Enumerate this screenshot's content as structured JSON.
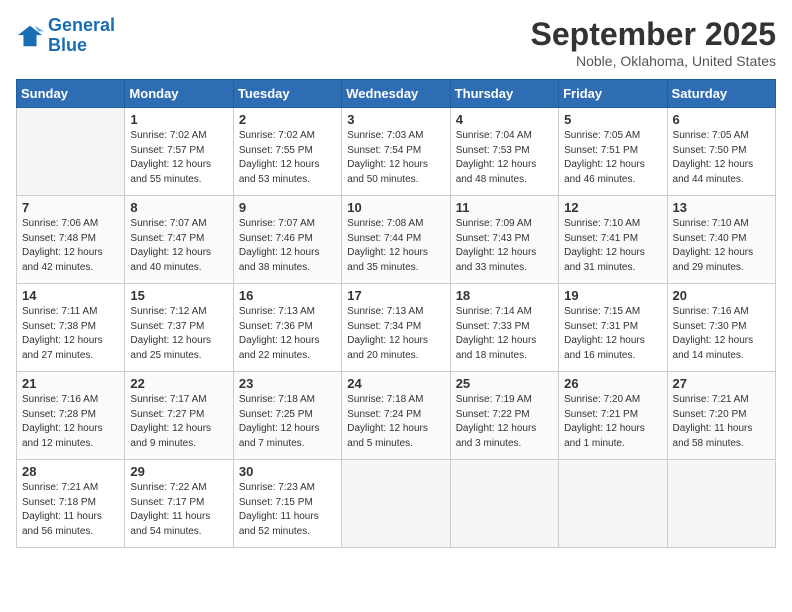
{
  "header": {
    "logo_line1": "General",
    "logo_line2": "Blue",
    "month_title": "September 2025",
    "location": "Noble, Oklahoma, United States"
  },
  "days_of_week": [
    "Sunday",
    "Monday",
    "Tuesday",
    "Wednesday",
    "Thursday",
    "Friday",
    "Saturday"
  ],
  "weeks": [
    [
      {
        "day": "",
        "info": ""
      },
      {
        "day": "1",
        "info": "Sunrise: 7:02 AM\nSunset: 7:57 PM\nDaylight: 12 hours\nand 55 minutes."
      },
      {
        "day": "2",
        "info": "Sunrise: 7:02 AM\nSunset: 7:55 PM\nDaylight: 12 hours\nand 53 minutes."
      },
      {
        "day": "3",
        "info": "Sunrise: 7:03 AM\nSunset: 7:54 PM\nDaylight: 12 hours\nand 50 minutes."
      },
      {
        "day": "4",
        "info": "Sunrise: 7:04 AM\nSunset: 7:53 PM\nDaylight: 12 hours\nand 48 minutes."
      },
      {
        "day": "5",
        "info": "Sunrise: 7:05 AM\nSunset: 7:51 PM\nDaylight: 12 hours\nand 46 minutes."
      },
      {
        "day": "6",
        "info": "Sunrise: 7:05 AM\nSunset: 7:50 PM\nDaylight: 12 hours\nand 44 minutes."
      }
    ],
    [
      {
        "day": "7",
        "info": "Sunrise: 7:06 AM\nSunset: 7:48 PM\nDaylight: 12 hours\nand 42 minutes."
      },
      {
        "day": "8",
        "info": "Sunrise: 7:07 AM\nSunset: 7:47 PM\nDaylight: 12 hours\nand 40 minutes."
      },
      {
        "day": "9",
        "info": "Sunrise: 7:07 AM\nSunset: 7:46 PM\nDaylight: 12 hours\nand 38 minutes."
      },
      {
        "day": "10",
        "info": "Sunrise: 7:08 AM\nSunset: 7:44 PM\nDaylight: 12 hours\nand 35 minutes."
      },
      {
        "day": "11",
        "info": "Sunrise: 7:09 AM\nSunset: 7:43 PM\nDaylight: 12 hours\nand 33 minutes."
      },
      {
        "day": "12",
        "info": "Sunrise: 7:10 AM\nSunset: 7:41 PM\nDaylight: 12 hours\nand 31 minutes."
      },
      {
        "day": "13",
        "info": "Sunrise: 7:10 AM\nSunset: 7:40 PM\nDaylight: 12 hours\nand 29 minutes."
      }
    ],
    [
      {
        "day": "14",
        "info": "Sunrise: 7:11 AM\nSunset: 7:38 PM\nDaylight: 12 hours\nand 27 minutes."
      },
      {
        "day": "15",
        "info": "Sunrise: 7:12 AM\nSunset: 7:37 PM\nDaylight: 12 hours\nand 25 minutes."
      },
      {
        "day": "16",
        "info": "Sunrise: 7:13 AM\nSunset: 7:36 PM\nDaylight: 12 hours\nand 22 minutes."
      },
      {
        "day": "17",
        "info": "Sunrise: 7:13 AM\nSunset: 7:34 PM\nDaylight: 12 hours\nand 20 minutes."
      },
      {
        "day": "18",
        "info": "Sunrise: 7:14 AM\nSunset: 7:33 PM\nDaylight: 12 hours\nand 18 minutes."
      },
      {
        "day": "19",
        "info": "Sunrise: 7:15 AM\nSunset: 7:31 PM\nDaylight: 12 hours\nand 16 minutes."
      },
      {
        "day": "20",
        "info": "Sunrise: 7:16 AM\nSunset: 7:30 PM\nDaylight: 12 hours\nand 14 minutes."
      }
    ],
    [
      {
        "day": "21",
        "info": "Sunrise: 7:16 AM\nSunset: 7:28 PM\nDaylight: 12 hours\nand 12 minutes."
      },
      {
        "day": "22",
        "info": "Sunrise: 7:17 AM\nSunset: 7:27 PM\nDaylight: 12 hours\nand 9 minutes."
      },
      {
        "day": "23",
        "info": "Sunrise: 7:18 AM\nSunset: 7:25 PM\nDaylight: 12 hours\nand 7 minutes."
      },
      {
        "day": "24",
        "info": "Sunrise: 7:18 AM\nSunset: 7:24 PM\nDaylight: 12 hours\nand 5 minutes."
      },
      {
        "day": "25",
        "info": "Sunrise: 7:19 AM\nSunset: 7:22 PM\nDaylight: 12 hours\nand 3 minutes."
      },
      {
        "day": "26",
        "info": "Sunrise: 7:20 AM\nSunset: 7:21 PM\nDaylight: 12 hours\nand 1 minute."
      },
      {
        "day": "27",
        "info": "Sunrise: 7:21 AM\nSunset: 7:20 PM\nDaylight: 11 hours\nand 58 minutes."
      }
    ],
    [
      {
        "day": "28",
        "info": "Sunrise: 7:21 AM\nSunset: 7:18 PM\nDaylight: 11 hours\nand 56 minutes."
      },
      {
        "day": "29",
        "info": "Sunrise: 7:22 AM\nSunset: 7:17 PM\nDaylight: 11 hours\nand 54 minutes."
      },
      {
        "day": "30",
        "info": "Sunrise: 7:23 AM\nSunset: 7:15 PM\nDaylight: 11 hours\nand 52 minutes."
      },
      {
        "day": "",
        "info": ""
      },
      {
        "day": "",
        "info": ""
      },
      {
        "day": "",
        "info": ""
      },
      {
        "day": "",
        "info": ""
      }
    ]
  ]
}
